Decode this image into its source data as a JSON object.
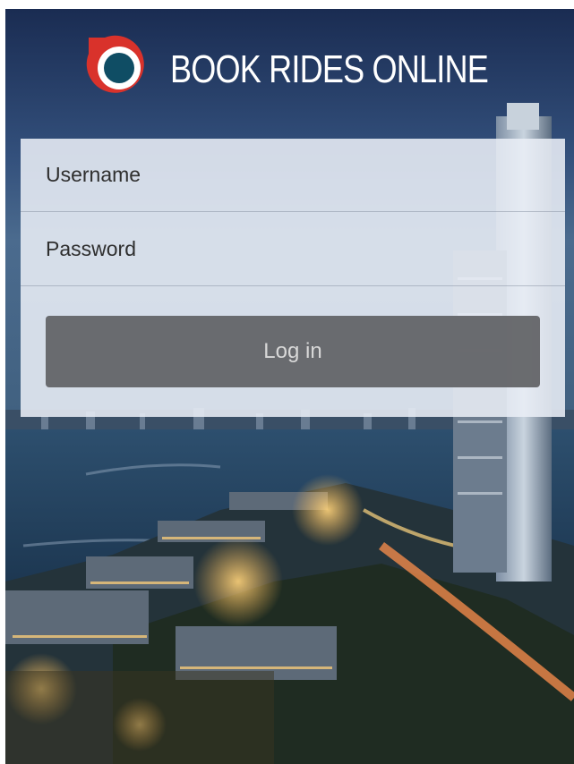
{
  "header": {
    "app_title": "BOOK RIDES ONLINE",
    "logo_icon": "ring-shield-icon"
  },
  "login_form": {
    "username_placeholder": "Username",
    "password_placeholder": "Password",
    "login_label": "Log in"
  },
  "colors": {
    "logo_red": "#d9322b",
    "logo_teal": "#0f4d64",
    "button_gray": "#5f6164",
    "card_overlay": "#e9eef6"
  }
}
